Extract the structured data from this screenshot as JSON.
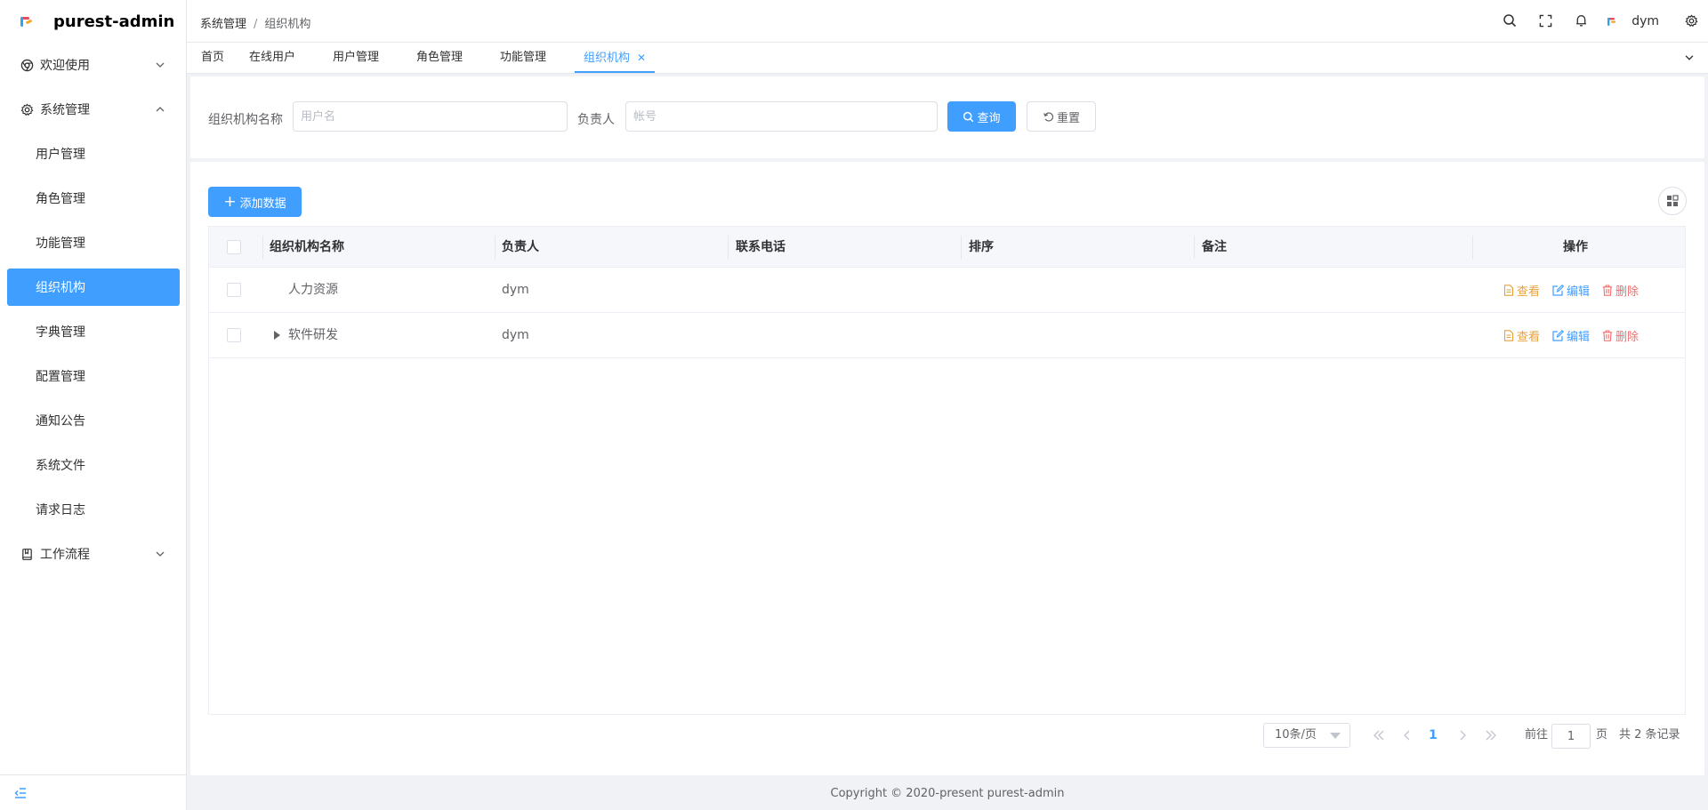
{
  "app": {
    "title": "purest-admin"
  },
  "sidebar": {
    "items": [
      {
        "label": "欢迎使用",
        "icon": "chrome-icon",
        "expanded": false
      },
      {
        "label": "系统管理",
        "icon": "gear-icon",
        "expanded": true
      },
      {
        "label": "用户管理"
      },
      {
        "label": "角色管理"
      },
      {
        "label": "功能管理"
      },
      {
        "label": "组织机构",
        "active": true
      },
      {
        "label": "字典管理"
      },
      {
        "label": "配置管理"
      },
      {
        "label": "通知公告"
      },
      {
        "label": "系统文件"
      },
      {
        "label": "请求日志"
      },
      {
        "label": "工作流程",
        "icon": "book-icon",
        "expanded": false
      }
    ]
  },
  "header": {
    "breadcrumb": [
      "系统管理",
      "组织机构"
    ],
    "breadcrumb_sep": "/",
    "user": "dym"
  },
  "tabs": {
    "items": [
      "首页",
      "在线用户",
      "用户管理",
      "角色管理",
      "功能管理",
      "组织机构"
    ],
    "active": "组织机构",
    "close_glyph": "✕"
  },
  "search": {
    "name_label": "组织机构名称",
    "name_placeholder": "用户名",
    "leader_label": "负责人",
    "leader_placeholder": "帐号",
    "query_button": "查询",
    "reset_button": "重置"
  },
  "toolbar": {
    "add_button": "添加数据"
  },
  "table": {
    "columns": [
      "组织机构名称",
      "负责人",
      "联系电话",
      "排序",
      "备注",
      "操作"
    ],
    "rows": [
      {
        "name": "人力资源",
        "leader": "dym",
        "phone": "",
        "sort": "",
        "remark": "",
        "has_children": false
      },
      {
        "name": "软件研发",
        "leader": "dym",
        "phone": "",
        "sort": "",
        "remark": "",
        "has_children": true
      }
    ],
    "actions": {
      "view": "查看",
      "edit": "编辑",
      "delete": "删除"
    }
  },
  "pagination": {
    "page_size": "10条/页",
    "current_page": "1",
    "goto_label": "前往",
    "goto_value": "1",
    "page_unit": "页",
    "total_text": "共 2 条记录"
  },
  "footer": {
    "copyright": "Copyright © 2020-present purest-admin"
  },
  "colors": {
    "primary": "#409eff",
    "warning": "#e6a23c",
    "danger": "#f56c6c"
  }
}
